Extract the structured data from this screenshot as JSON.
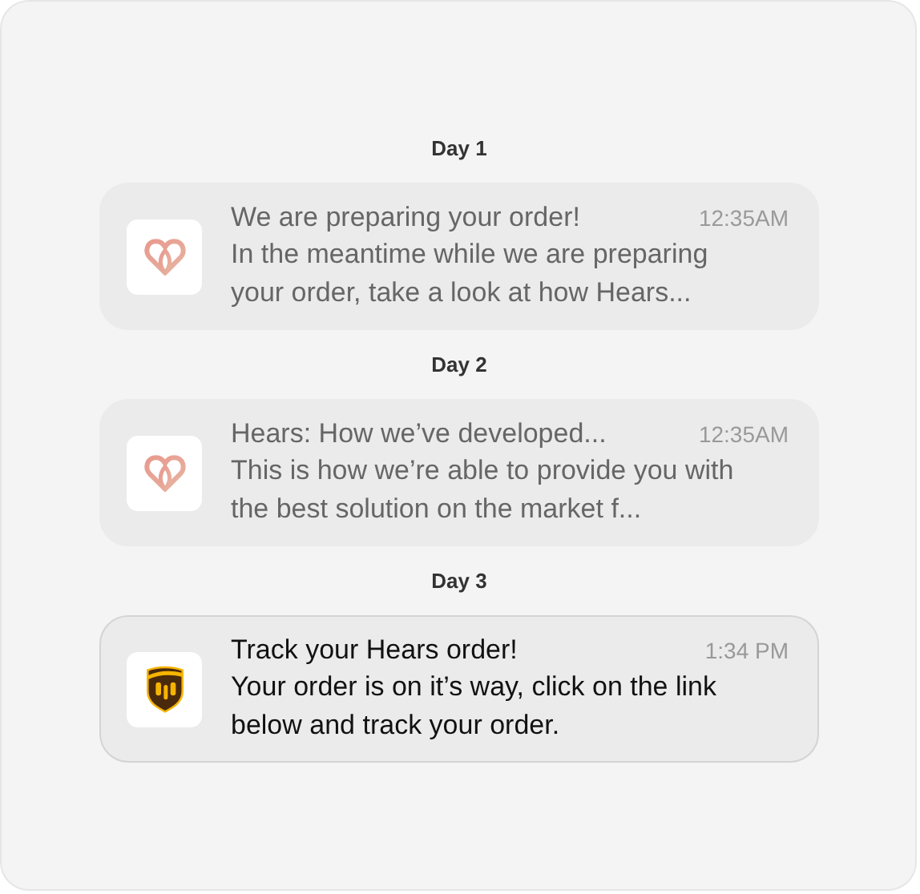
{
  "groups": [
    {
      "day": "Day 1",
      "notification": {
        "kind": "heart",
        "read": true,
        "title": "We are preparing your order!",
        "time": "12:35AM",
        "body": "In the meantime while we are preparing your order, take a look at how Hears..."
      }
    },
    {
      "day": "Day 2",
      "notification": {
        "kind": "heart",
        "read": true,
        "title": "Hears: How we’ve developed...",
        "time": "12:35AM",
        "body": "This is how we’re able to provide you with the best solution on the market f..."
      }
    },
    {
      "day": "Day 3",
      "notification": {
        "kind": "shield",
        "read": false,
        "title": "Track your Hears order!",
        "time": "1:34 PM",
        "body": "Your order is on it’s way, click on the link below and track your order."
      }
    }
  ]
}
